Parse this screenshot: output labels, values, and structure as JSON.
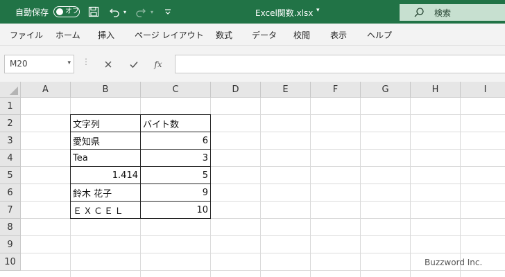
{
  "titlebar": {
    "autosave_label": "自動保存",
    "autosave_toggle": "オフ",
    "filename": "Excel関数.xlsx",
    "search_placeholder": "検索"
  },
  "ribbon": {
    "tabs": [
      "ファイル",
      "ホーム",
      "挿入",
      "ページ レイアウト",
      "数式",
      "データ",
      "校閲",
      "表示",
      "ヘルプ"
    ]
  },
  "formula_bar": {
    "name_box": "M20",
    "fx_label": "fx",
    "formula": ""
  },
  "sheet": {
    "columns": [
      "A",
      "B",
      "C",
      "D",
      "E",
      "F",
      "G",
      "H",
      "I"
    ],
    "rows": [
      "1",
      "2",
      "3",
      "4",
      "5",
      "6",
      "7",
      "8",
      "9",
      "10"
    ],
    "table": {
      "header": [
        "文字列",
        "バイト数"
      ],
      "rows": [
        [
          "愛知県",
          "6"
        ],
        [
          "Tea",
          "3"
        ],
        [
          "1.414",
          "5"
        ],
        [
          "鈴木 花子",
          "9"
        ],
        [
          "ＥＸＣＥＬ",
          "10"
        ]
      ]
    }
  },
  "watermark": "Buzzword Inc."
}
